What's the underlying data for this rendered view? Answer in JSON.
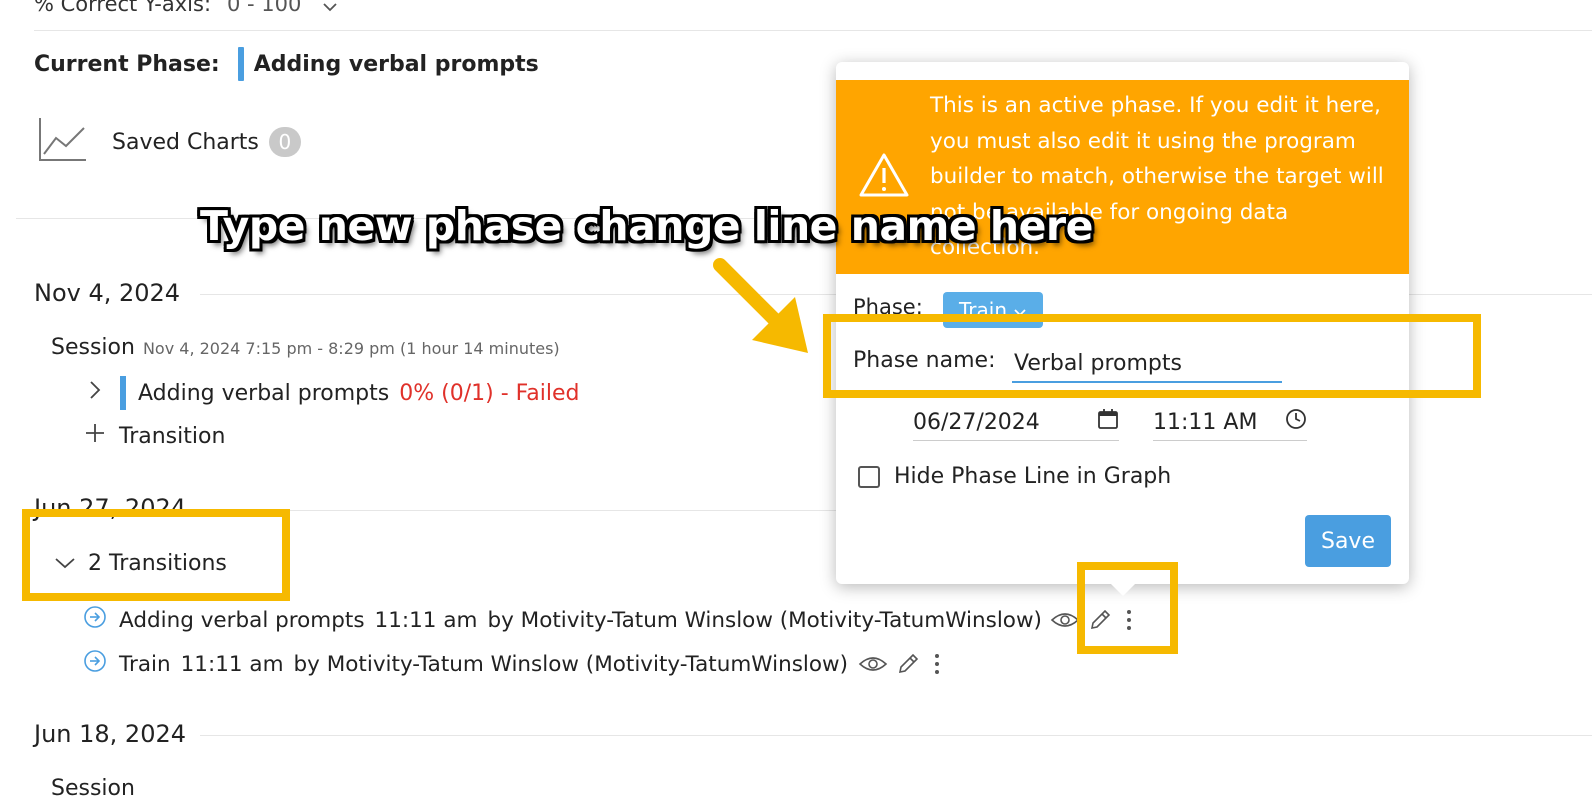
{
  "top_axis": {
    "label": "% Correct Y-axis:",
    "value": "0 - 100"
  },
  "current_phase": {
    "label": "Current Phase:",
    "value": "Adding verbal prompts"
  },
  "saved_charts": {
    "label": "Saved Charts",
    "count": "0"
  },
  "dates": {
    "nov4": "Nov 4, 2024",
    "jun27": "Jun 27, 2024",
    "jun18": "Jun 18, 2024"
  },
  "session": {
    "label": "Session",
    "meta": "Nov 4, 2024 7:15 pm - 8:29 pm (1 hour 14 minutes)",
    "entry_name": "Adding verbal prompts",
    "entry_result": "0% (0/1) - Failed",
    "add_transition": "Transition"
  },
  "transitions": {
    "summary": "2 Transitions",
    "items": [
      {
        "name": "Adding verbal prompts",
        "time": "11:11 am",
        "by": "by Motivity-Tatum Winslow (Motivity-TatumWinslow)"
      },
      {
        "name": "Train",
        "time": "11:11 am",
        "by": "by Motivity-Tatum Winslow (Motivity-TatumWinslow)"
      }
    ]
  },
  "jun18_session_label": "Session",
  "popup": {
    "warning": "This is an active phase. If you edit it here, you must also edit it using the program builder to match, otherwise the target will not be available for ongoing data collection.",
    "phase_label": "Phase:",
    "phase_value": "Train",
    "phase_name_label": "Phase name:",
    "phase_name_value": "Verbal prompts",
    "date": "06/27/2024",
    "time": "11:11 AM",
    "hide_label": "Hide Phase Line in Graph",
    "save": "Save"
  },
  "callout": "Type new phase change line name here",
  "colors": {
    "accent": "#4a9ee0",
    "warning": "#ffa500",
    "failed": "#e0312a",
    "highlight": "#f6b900"
  }
}
